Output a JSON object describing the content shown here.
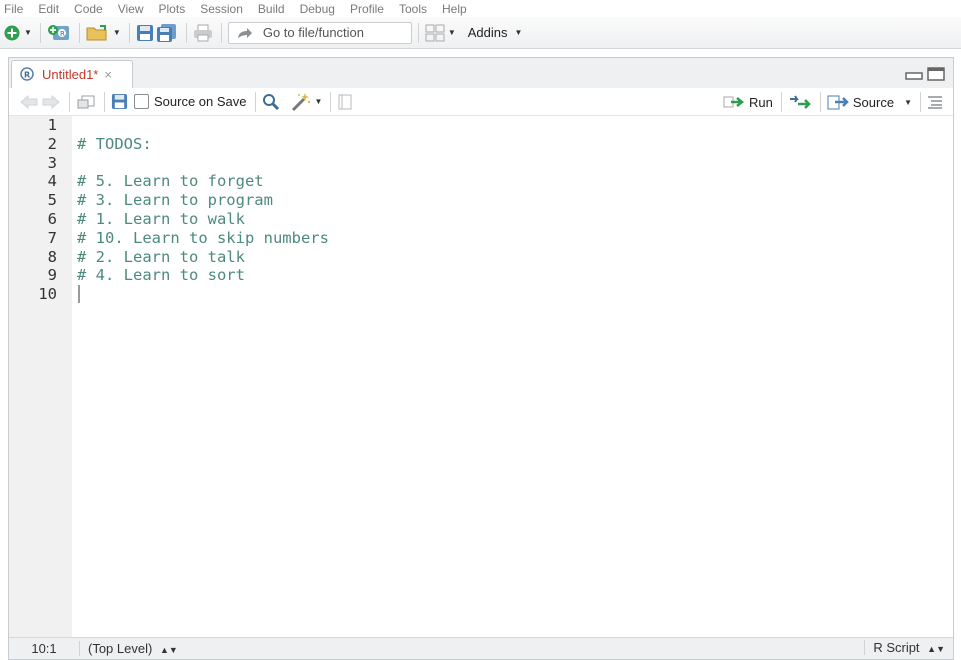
{
  "menu": [
    "File",
    "Edit",
    "Code",
    "View",
    "Plots",
    "Session",
    "Build",
    "Debug",
    "Profile",
    "Tools",
    "Help"
  ],
  "toolbar": {
    "goto_placeholder": "Go to file/function",
    "addins_label": "Addins"
  },
  "tab": {
    "title": "Untitled1*",
    "close": "×"
  },
  "editor_toolbar": {
    "source_on_save_label": "Source on Save",
    "run_label": "Run",
    "source_label": "Source"
  },
  "editor": {
    "line_numbers": [
      "1",
      "2",
      "3",
      "4",
      "5",
      "6",
      "7",
      "8",
      "9",
      "10"
    ],
    "lines": [
      "",
      "# TODOS:",
      "",
      "# 5. Learn to forget",
      "# 3. Learn to program",
      "# 1. Learn to walk",
      "# 10. Learn to skip numbers",
      "# 2. Learn to talk",
      "# 4. Learn to sort",
      ""
    ]
  },
  "status": {
    "position": "10:1",
    "scope": "(Top Level)",
    "file_type": "R Script"
  },
  "colors": {
    "comment": "#4d8a7e",
    "tab_title": "#c0392b"
  }
}
